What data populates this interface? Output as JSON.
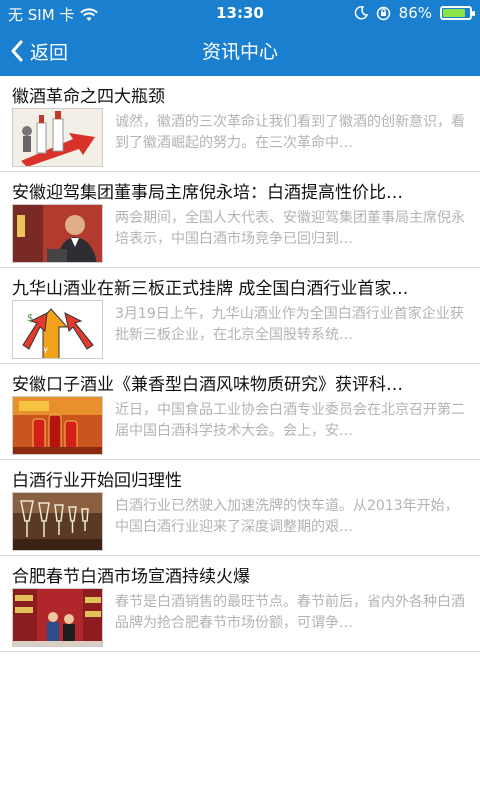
{
  "status": {
    "carrier": "无 SIM 卡",
    "time": "13:30",
    "battery_text": "86%",
    "battery_level": 0.86
  },
  "nav": {
    "back_label": "返回",
    "title": "资讯中心"
  },
  "colors": {
    "header_bg": "#1b7fd0",
    "title_text": "#111111",
    "summary_text": "#b3b3b3"
  },
  "news": [
    {
      "title": "徽酒革命之四大瓶颈",
      "summary": "诚然，徽酒的三次革命让我们看到了徽酒的创新意识，看到了徽酒崛起的努力。在三次革命中…",
      "thumb": "bottles-arrow"
    },
    {
      "title": "安徽迎驾集团董事局主席倪永培：白酒提高性价比…",
      "summary": "两会期间，全国人大代表、安徽迎驾集团董事局主席倪永培表示，中国白酒市场竞争已回归到…",
      "thumb": "portrait"
    },
    {
      "title": "九华山酒业在新三板正式挂牌 成全国白酒行业首家…",
      "summary": "3月19日上午，九华山酒业作为全国白酒行业首家企业获批新三板企业，在北京全国股转系统…",
      "thumb": "arrows-graphic"
    },
    {
      "title": "安徽口子酒业《兼香型白酒风味物质研究》获评科…",
      "summary": "近日，中国食品工业协会白酒专业委员会在北京召开第二届中国白酒科学技术大会。会上，安…",
      "thumb": "red-bottles"
    },
    {
      "title": "白酒行业开始回归理性",
      "summary": "白酒行业已然驶入加速洗牌的快车道。从2013年开始，中国白酒行业迎来了深度调整期的艰…",
      "thumb": "wine-glasses"
    },
    {
      "title": "合肥春节白酒市场宣酒持续火爆",
      "summary": "春节是白酒销售的最旺节点。春节前后，省内外各种白酒品牌为抢合肥春节市场份额，可谓争…",
      "thumb": "store-shelves"
    }
  ]
}
